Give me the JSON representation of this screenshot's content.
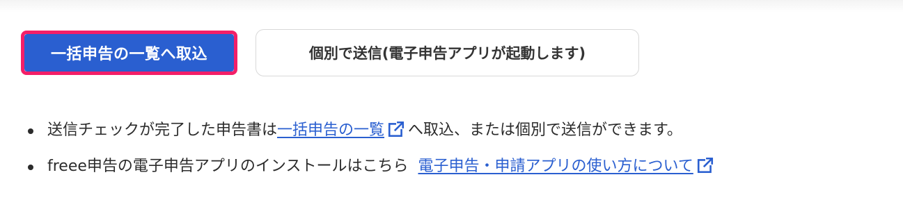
{
  "actions": {
    "bulk_import_label": "一括申告の一覧へ取込",
    "individual_send_label": "個別で送信(電子申告アプリが起動します)"
  },
  "notes": {
    "item1": {
      "prefix": "送信チェックが完了した申告書は",
      "link": "一括申告の一覧",
      "suffix": "へ取込、または個別で送信ができます。"
    },
    "item2": {
      "text": "freee申告の電子申告アプリのインストールはこちら",
      "link": "電子申告・申請アプリの使い方について"
    }
  },
  "colors": {
    "primary": "#2a5fd0",
    "highlight": "#f31f68",
    "link": "#2a5fd0"
  },
  "icons": {
    "external_link": "external-link-icon"
  }
}
